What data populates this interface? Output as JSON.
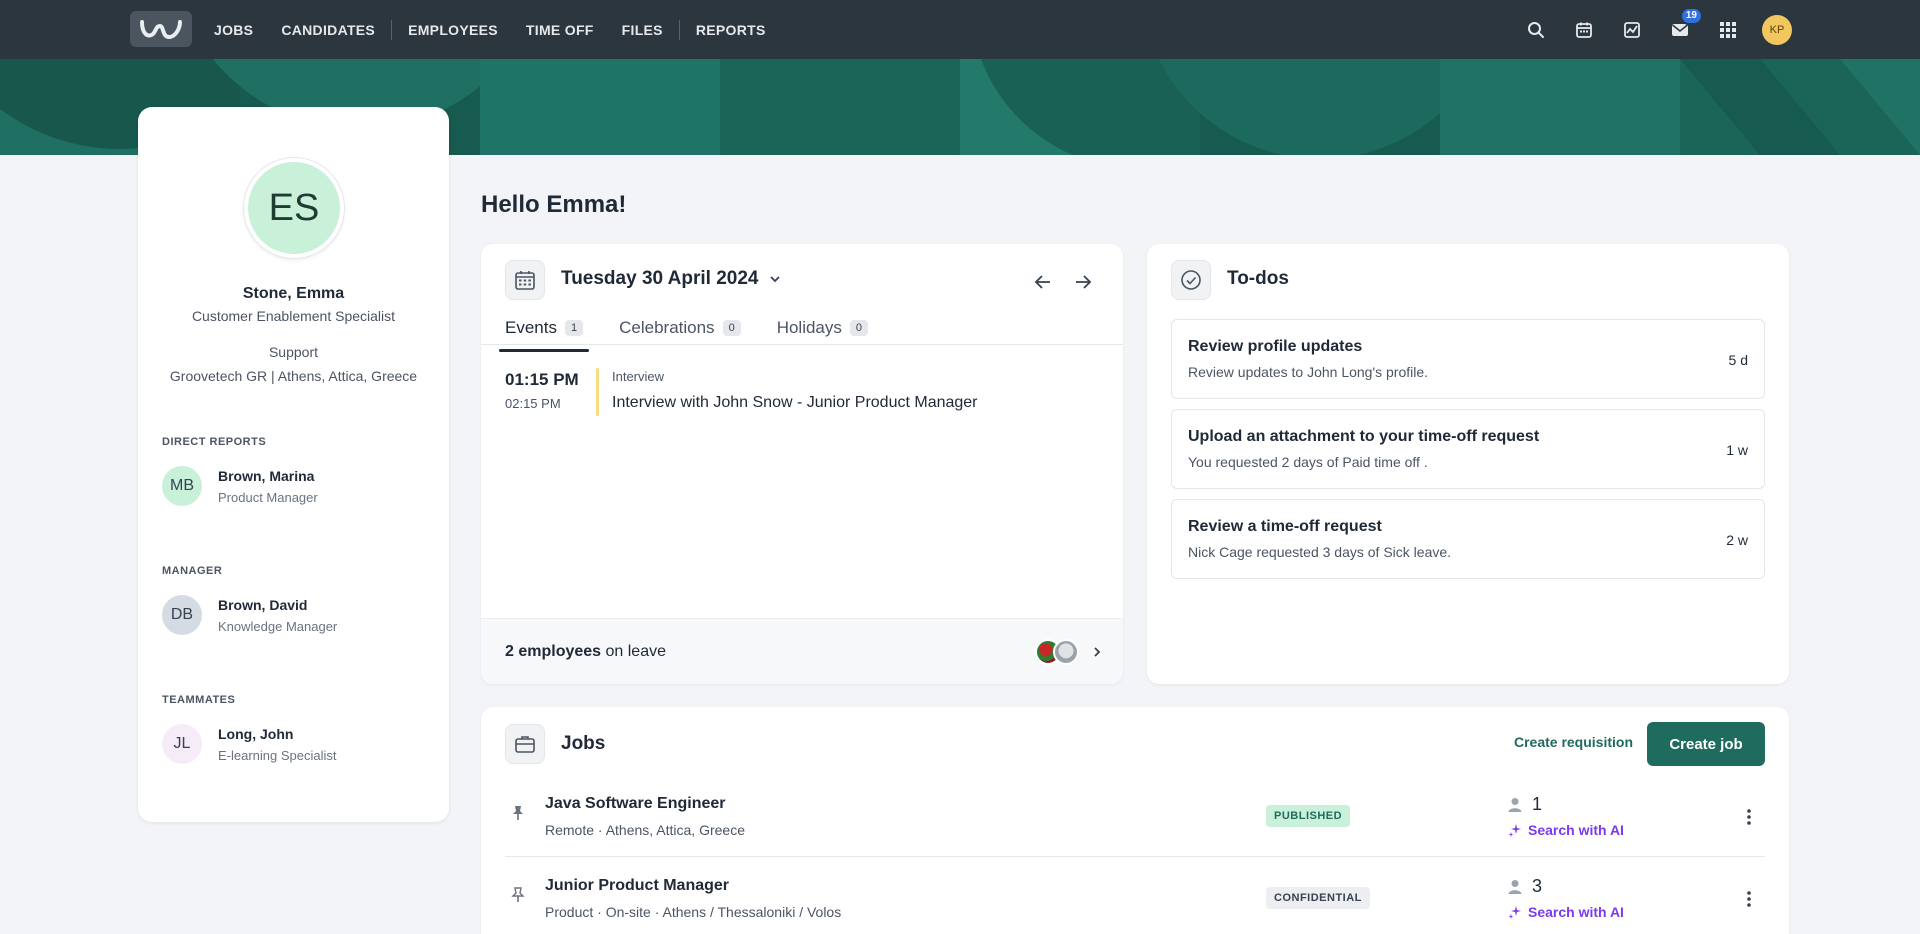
{
  "nav": {
    "items": [
      "JOBS",
      "CANDIDATES",
      "EMPLOYEES",
      "TIME OFF",
      "FILES",
      "REPORTS"
    ],
    "inbox_badge": "19",
    "user_initials": "KP"
  },
  "colors": {
    "topbar": "#2c363f",
    "banner": "#1e7062",
    "brand_green": "#1f6b5e",
    "ai_purple": "#7c3aed",
    "badge_blue": "#2f6fe0"
  },
  "profile": {
    "initials": "ES",
    "name": "Stone, Emma",
    "title": "Customer Enablement Specialist",
    "department": "Support",
    "location": "Groovetech GR | Athens, Attica, Greece",
    "direct_reports_label": "DIRECT REPORTS",
    "direct_reports": [
      {
        "initials": "MB",
        "name": "Brown, Marina",
        "role": "Product Manager"
      }
    ],
    "manager_label": "MANAGER",
    "manager": {
      "initials": "DB",
      "name": "Brown, David",
      "role": "Knowledge Manager"
    },
    "teammates_label": "TEAMMATES",
    "teammates": [
      {
        "initials": "JL",
        "name": "Long, John",
        "role": "E-learning Specialist"
      }
    ]
  },
  "greeting": "Hello Emma!",
  "events": {
    "date": "Tuesday 30 April 2024",
    "tabs": [
      {
        "label": "Events",
        "count": "1"
      },
      {
        "label": "Celebrations",
        "count": "0"
      },
      {
        "label": "Holidays",
        "count": "0"
      }
    ],
    "items": [
      {
        "start": "01:15 PM",
        "end": "02:15 PM",
        "type": "Interview",
        "title": "Interview with John Snow - Junior Product Manager"
      }
    ],
    "leave_count": "2 employees",
    "leave_suffix": " on leave"
  },
  "todos": {
    "title": "To-dos",
    "items": [
      {
        "title": "Review profile updates",
        "desc": "Review updates to John Long's profile.",
        "age": "5 d"
      },
      {
        "title": "Upload an attachment to your time-off request",
        "desc": "You requested 2 days of Paid time off .",
        "age": "1 w"
      },
      {
        "title": "Review a time-off request",
        "desc": "Nick Cage requested 3 days of Sick leave.",
        "age": "2 w"
      }
    ]
  },
  "jobs": {
    "title": "Jobs",
    "create_requisition": "Create requisition",
    "create_job": "Create job",
    "ai_label": "Search with AI",
    "items": [
      {
        "name": "Java Software Engineer",
        "meta": "Remote · Athens, Attica, Greece",
        "status": "PUBLISHED",
        "count": "1"
      },
      {
        "name": "Junior Product Manager",
        "meta": "Product · On-site · Athens / Thessaloniki / Volos",
        "status": "CONFIDENTIAL",
        "count": "3"
      }
    ]
  }
}
